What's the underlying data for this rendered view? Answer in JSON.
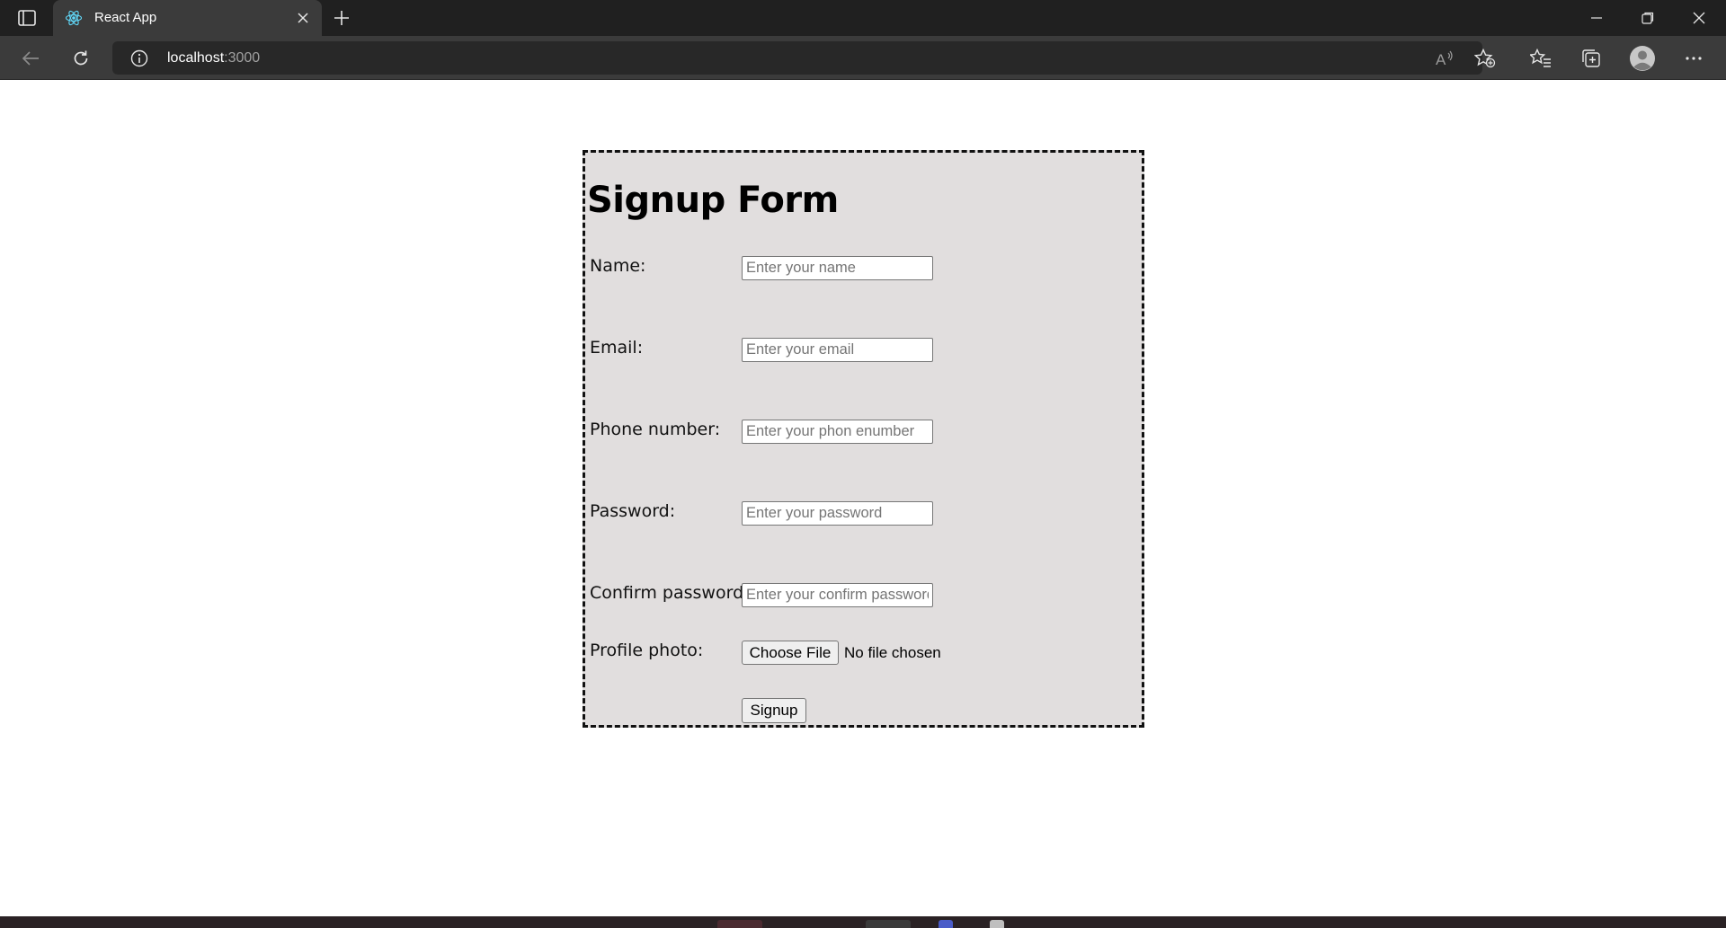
{
  "browser": {
    "tab_title": "React App",
    "url_host": "localhost",
    "url_port": ":3000"
  },
  "form": {
    "title": "Signup Form",
    "fields": [
      {
        "label": "Name:",
        "placeholder": "Enter your name"
      },
      {
        "label": "Email:",
        "placeholder": "Enter your email"
      },
      {
        "label": "Phone number:",
        "placeholder": "Enter your phon enumber"
      },
      {
        "label": "Password:",
        "placeholder": "Enter your password"
      },
      {
        "label": "Confirm password:",
        "placeholder": "Enter your confirm password"
      }
    ],
    "photo": {
      "label": "Profile photo:",
      "button_label": "Choose File",
      "status": "No file chosen"
    },
    "submit_label": "Signup"
  },
  "colors": {
    "form_background": "#e1dede",
    "chrome_dark": "#202020",
    "chrome_toolbar": "#3b3b3b"
  }
}
